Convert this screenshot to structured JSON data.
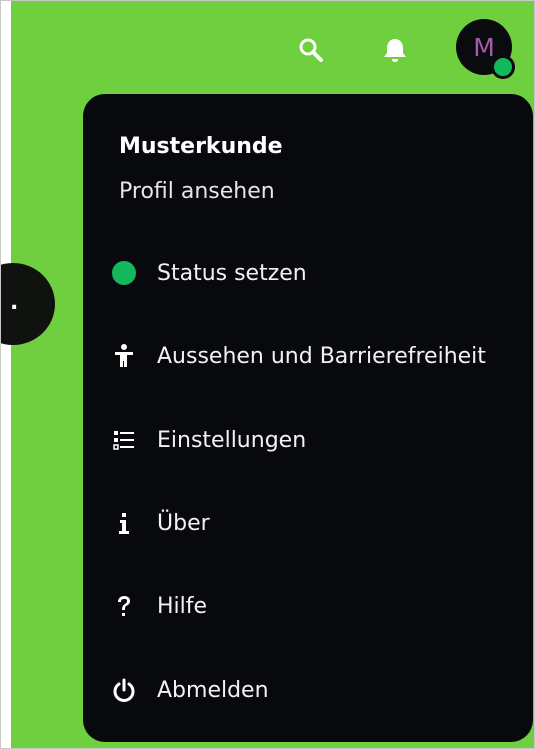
{
  "header": {
    "search_icon": "search-icon",
    "notification_icon": "bell-icon",
    "avatar_initial": "M",
    "avatar_status_color": "#13b85a"
  },
  "background_text": ".",
  "menu": {
    "title": "Musterkunde",
    "profile_link": "Profil ansehen",
    "items": [
      {
        "label": "Status setzen",
        "icon": "status-dot-icon"
      },
      {
        "label": "Aussehen und Barrierefreiheit",
        "icon": "accessibility-icon"
      },
      {
        "label": "Einstellungen",
        "icon": "settings-list-icon"
      },
      {
        "label": "Über",
        "icon": "info-icon"
      },
      {
        "label": "Hilfe",
        "icon": "help-icon"
      },
      {
        "label": "Abmelden",
        "icon": "power-icon"
      }
    ]
  },
  "colors": {
    "background_green": "#6fcf3f",
    "menu_background": "#07090d",
    "status_green": "#12b85a",
    "avatar_letter": "#a65aa8"
  }
}
